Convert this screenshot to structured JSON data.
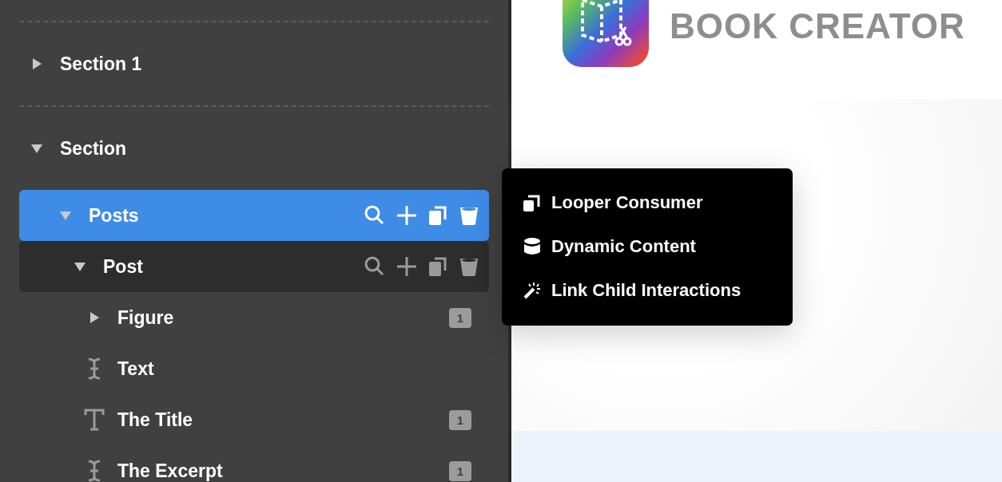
{
  "layers": [
    {
      "label": "Section 1",
      "expanded": false
    },
    {
      "label": "Section",
      "expanded": true,
      "children": [
        {
          "label": "Posts",
          "expanded": true,
          "selected": true,
          "children": [
            {
              "label": "Post",
              "expanded": true,
              "selected": false,
              "hovered": true,
              "children": [
                {
                  "label": "Figure",
                  "expanded": false,
                  "selected": false,
                  "hovered": false,
                  "badge": "1"
                },
                {
                  "label": "Text",
                  "kind": "text",
                  "selected": false,
                  "hovered": false
                },
                {
                  "label": "The Title",
                  "kind": "heading",
                  "selected": false,
                  "hovered": false,
                  "badge": "1"
                },
                {
                  "label": "The Excerpt",
                  "kind": "text",
                  "selected": false,
                  "hovered": false,
                  "badge": "1"
                }
              ]
            }
          ]
        }
      ]
    }
  ],
  "context_menu": [
    {
      "label": "Looper Consumer",
      "kind": "looper"
    },
    {
      "label": "Dynamic Content",
      "kind": "dynamic"
    },
    {
      "label": "Link Child Interactions",
      "kind": "link"
    }
  ],
  "brand": {
    "name": "BOOK CREATOR"
  }
}
